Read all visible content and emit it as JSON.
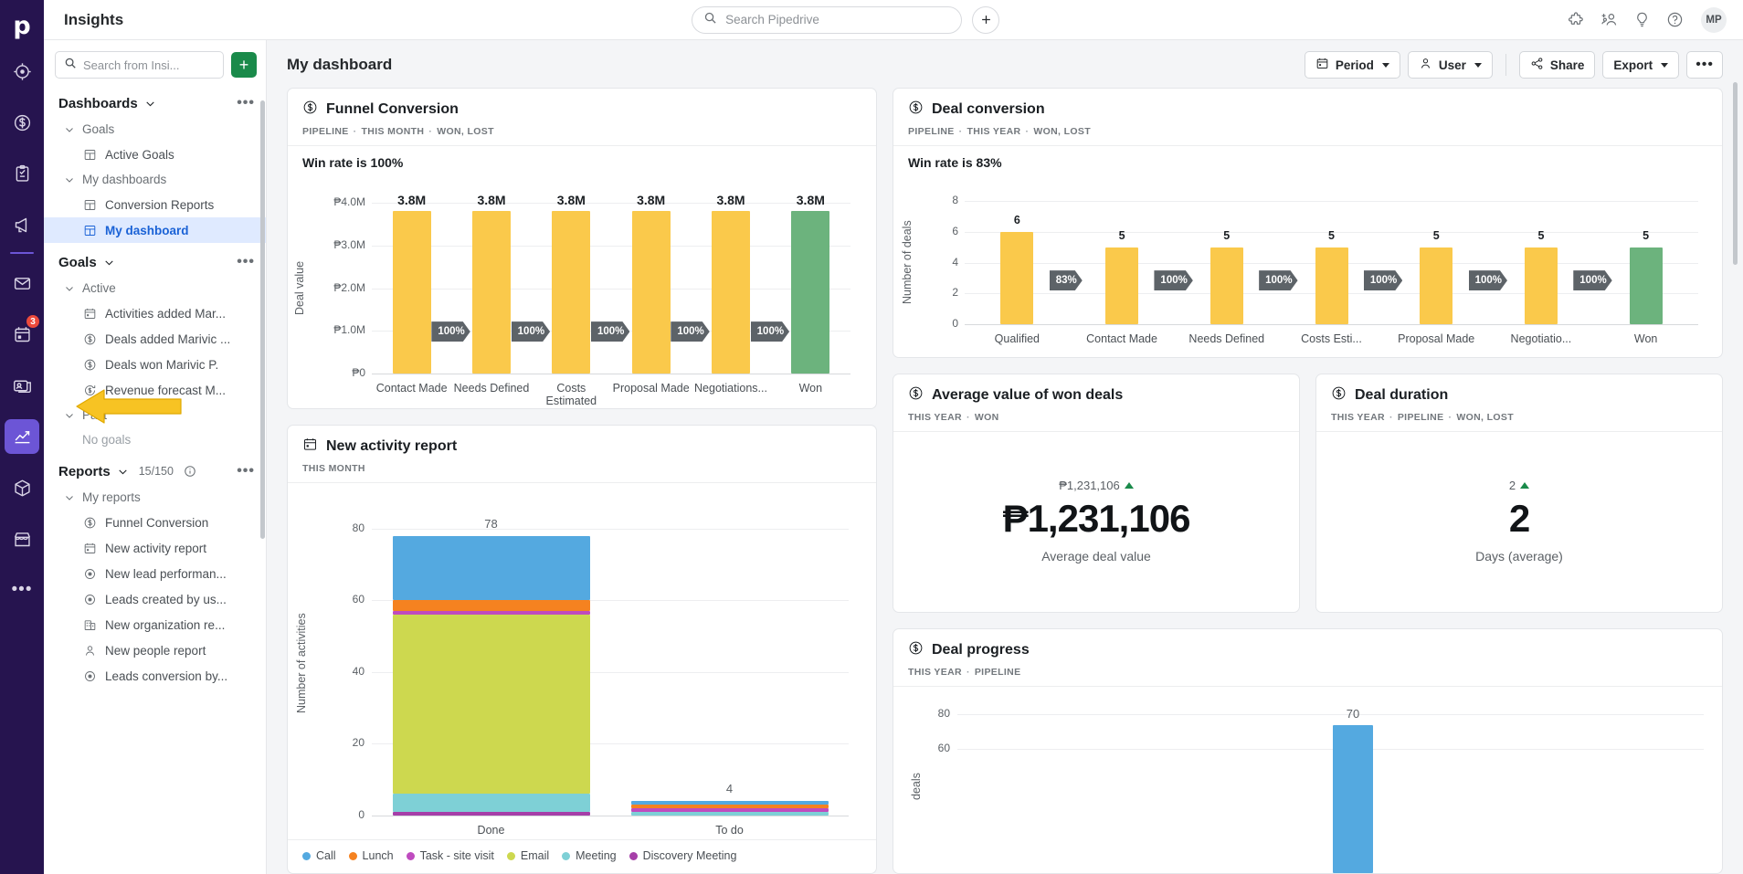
{
  "rail": {
    "logo": "p",
    "items": [
      {
        "name": "leads-icon",
        "label": "Leads"
      },
      {
        "name": "deals-icon",
        "label": "Deals"
      },
      {
        "name": "activities-icon",
        "label": "Activities"
      },
      {
        "name": "campaigns-icon",
        "label": "Campaigns"
      },
      {
        "name": "mail-icon",
        "label": "Mail"
      },
      {
        "name": "calendar-icon",
        "label": "Calendar",
        "badge": "3"
      },
      {
        "name": "contacts-icon",
        "label": "Contacts"
      },
      {
        "name": "insights-icon",
        "label": "Insights",
        "active": true
      },
      {
        "name": "products-icon",
        "label": "Products"
      },
      {
        "name": "marketplace-icon",
        "label": "Marketplace"
      },
      {
        "name": "more-icon",
        "label": "More"
      }
    ]
  },
  "topbar": {
    "title": "Insights",
    "search_placeholder": "Search Pipedrive",
    "search_value": "",
    "add_label": "+",
    "icons": [
      {
        "name": "puzzle-icon",
        "label": "Apps"
      },
      {
        "name": "invite-user-icon",
        "label": "Invite users"
      },
      {
        "name": "lightbulb-icon",
        "label": "Tips"
      },
      {
        "name": "help-icon",
        "label": "Help"
      }
    ],
    "avatar_initials": "MP"
  },
  "sidebar": {
    "search_placeholder": "Search from Insi...",
    "search_value": "",
    "add_button_label": "+",
    "sections": [
      {
        "name": "dashboards",
        "title": "Dashboards",
        "count": "",
        "has_info": false,
        "groups": [
          {
            "label": "Goals",
            "items": [
              {
                "label": "Active Goals",
                "icon": "dashboard-icon",
                "selected": false
              }
            ]
          },
          {
            "label": "My dashboards",
            "items": [
              {
                "label": "Conversion Reports",
                "icon": "dashboard-icon",
                "selected": false
              },
              {
                "label": "My dashboard",
                "icon": "dashboard-icon",
                "selected": true
              }
            ]
          }
        ]
      },
      {
        "name": "goals",
        "title": "Goals",
        "count": "",
        "has_info": false,
        "groups": [
          {
            "label": "Active",
            "items": [
              {
                "label": "Activities added Mar...",
                "icon": "calendar-icon",
                "selected": false
              },
              {
                "label": "Deals added Marivic ...",
                "icon": "deal-icon",
                "selected": false
              },
              {
                "label": "Deals won Marivic P.",
                "icon": "deal-icon",
                "selected": false
              },
              {
                "label": "Revenue forecast M...",
                "icon": "revenue-icon",
                "selected": false
              }
            ]
          },
          {
            "label": "Past",
            "items": [
              {
                "label": "No goals",
                "icon": "none",
                "muted": true
              }
            ]
          }
        ]
      },
      {
        "name": "reports",
        "title": "Reports",
        "count": "15/150",
        "has_info": true,
        "groups": [
          {
            "label": "My reports",
            "items": [
              {
                "label": "Funnel Conversion",
                "icon": "deal-icon",
                "selected": false
              },
              {
                "label": "New activity report",
                "icon": "calendar-icon",
                "selected": false
              },
              {
                "label": "New lead performan...",
                "icon": "lead-icon",
                "selected": false
              },
              {
                "label": "Leads created by us...",
                "icon": "lead-icon",
                "selected": false
              },
              {
                "label": "New organization re...",
                "icon": "organization-icon",
                "selected": false
              },
              {
                "label": "New people report",
                "icon": "person-icon",
                "selected": false
              },
              {
                "label": "Leads conversion by...",
                "icon": "lead-icon",
                "selected": false
              }
            ]
          }
        ]
      }
    ]
  },
  "main": {
    "dashboard_title": "My dashboard",
    "toolbar": {
      "period_label": "Period",
      "user_label": "User",
      "share_label": "Share",
      "export_label": "Export",
      "more_label": "•••"
    }
  },
  "cards": {
    "funnel_conversion": {
      "title": "Funnel Conversion",
      "icon": "deal-icon",
      "meta": [
        "PIPELINE",
        "THIS MONTH",
        "WON, LOST"
      ],
      "subtitle": "Win rate is 100%"
    },
    "deal_conversion": {
      "title": "Deal conversion",
      "icon": "deal-icon",
      "meta": [
        "PIPELINE",
        "THIS YEAR",
        "WON, LOST"
      ],
      "subtitle": "Win rate is 83%"
    },
    "new_activity_report": {
      "title": "New activity report",
      "icon": "calendar-icon",
      "meta": [
        "THIS MONTH"
      ]
    },
    "average_value_won": {
      "title": "Average value of won deals",
      "icon": "deal-icon",
      "meta": [
        "THIS YEAR",
        "WON"
      ],
      "previous": "₱1,231,106",
      "trend": "up",
      "value": "₱1,231,106",
      "caption": "Average deal value"
    },
    "deal_duration": {
      "title": "Deal duration",
      "icon": "deal-icon",
      "meta": [
        "THIS YEAR",
        "PIPELINE",
        "WON, LOST"
      ],
      "previous": "2",
      "trend": "up",
      "value": "2",
      "caption": "Days (average)"
    },
    "deal_progress": {
      "title": "Deal progress",
      "icon": "deal-icon",
      "meta": [
        "THIS YEAR",
        "PIPELINE"
      ]
    }
  },
  "chart_data": [
    {
      "id": "funnel_conversion",
      "type": "bar",
      "title": "Funnel Conversion",
      "xlabel": "",
      "ylabel": "Deal value",
      "categories": [
        "Contact Made",
        "Needs Defined",
        "Costs Estimated",
        "Proposal Made",
        "Negotiations...",
        "Won"
      ],
      "values": [
        3800000,
        3800000,
        3800000,
        3800000,
        3800000,
        3800000
      ],
      "data_labels": [
        "3.8M",
        "3.8M",
        "3.8M",
        "3.8M",
        "3.8M",
        "3.8M"
      ],
      "bar_colors": [
        "#fac94b",
        "#fac94b",
        "#fac94b",
        "#fac94b",
        "#fac94b",
        "#6cb37d"
      ],
      "conversion_labels": [
        "100%",
        "100%",
        "100%",
        "100%",
        "100%"
      ],
      "yticks": [
        "₱0",
        "₱1.0M",
        "₱2.0M",
        "₱3.0M",
        "₱4.0M"
      ],
      "ylim": [
        0,
        4000000
      ],
      "grid": true,
      "legend": "none"
    },
    {
      "id": "deal_conversion",
      "type": "bar",
      "title": "Deal conversion",
      "xlabel": "",
      "ylabel": "Number of deals",
      "categories": [
        "Qualified",
        "Contact Made",
        "Needs Defined",
        "Costs Esti...",
        "Proposal Made",
        "Negotiatio...",
        "Won"
      ],
      "values": [
        6,
        5,
        5,
        5,
        5,
        5,
        5
      ],
      "data_labels": [
        "6",
        "5",
        "5",
        "5",
        "5",
        "5",
        "5"
      ],
      "bar_colors": [
        "#fac94b",
        "#fac94b",
        "#fac94b",
        "#fac94b",
        "#fac94b",
        "#fac94b",
        "#6cb37d"
      ],
      "conversion_labels": [
        "83%",
        "100%",
        "100%",
        "100%",
        "100%",
        "100%"
      ],
      "yticks": [
        "0",
        "2",
        "4",
        "6",
        "8"
      ],
      "ylim": [
        0,
        8
      ],
      "grid": true,
      "legend": "none"
    },
    {
      "id": "new_activity_report",
      "type": "bar",
      "title": "New activity report",
      "xlabel": "",
      "ylabel": "Number of activities",
      "categories": [
        "Done",
        "To do"
      ],
      "totals": [
        78,
        4
      ],
      "data_labels": [
        "78",
        "4"
      ],
      "yticks": [
        "0",
        "20",
        "40",
        "60",
        "80"
      ],
      "ylim": [
        0,
        85
      ],
      "grid": true,
      "legend_position": "bottom",
      "series": [
        {
          "name": "Call",
          "color": "#54a9e0",
          "values": [
            18,
            1
          ]
        },
        {
          "name": "Lunch",
          "color": "#f58220",
          "values": [
            3,
            1
          ]
        },
        {
          "name": "Task - site visit",
          "color": "#bf4bbf",
          "values": [
            1,
            1
          ]
        },
        {
          "name": "Email",
          "color": "#cdd84f",
          "values": [
            50,
            0
          ]
        },
        {
          "name": "Meeting",
          "color": "#7ed0d6",
          "values": [
            5,
            1
          ]
        },
        {
          "name": "Discovery Meeting",
          "color": "#a63fa8",
          "values": [
            1,
            0
          ]
        }
      ]
    },
    {
      "id": "deal_progress",
      "type": "bar",
      "title": "Deal progress",
      "xlabel": "",
      "ylabel": "deals",
      "categories": [
        ""
      ],
      "values": [
        70
      ],
      "data_labels": [
        "70"
      ],
      "bar_colors": [
        "#54a9e0"
      ],
      "yticks": [
        "60",
        "80"
      ],
      "ylim": [
        0,
        85
      ],
      "grid": true,
      "legend": "none"
    }
  ]
}
